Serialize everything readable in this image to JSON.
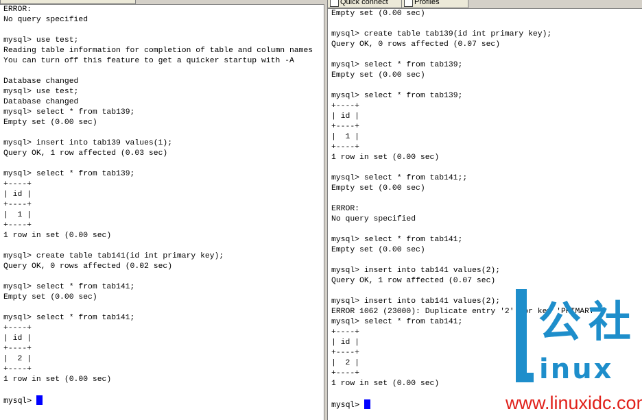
{
  "right_tabs": {
    "tab1": "Quick connect",
    "tab2": "Profiles"
  },
  "left_terminal": {
    "lines": [
      "ERROR:",
      "No query specified",
      "",
      "mysql> use test;",
      "Reading table information for completion of table and column names",
      "You can turn off this feature to get a quicker startup with -A",
      "",
      "Database changed",
      "mysql> use test;",
      "Database changed",
      "mysql> select * from tab139;",
      "Empty set (0.00 sec)",
      "",
      "mysql> insert into tab139 values(1);",
      "Query OK, 1 row affected (0.03 sec)",
      "",
      "mysql> select * from tab139;",
      "+----+",
      "| id |",
      "+----+",
      "|  1 |",
      "+----+",
      "1 row in set (0.00 sec)",
      "",
      "mysql> create table tab141(id int primary key);",
      "Query OK, 0 rows affected (0.02 sec)",
      "",
      "mysql> select * from tab141;",
      "Empty set (0.00 sec)",
      "",
      "mysql> select * from tab141;",
      "+----+",
      "| id |",
      "+----+",
      "|  2 |",
      "+----+",
      "1 row in set (0.00 sec)",
      ""
    ],
    "prompt": "mysql> "
  },
  "right_terminal": {
    "lines": [
      "Empty set (0.00 sec)",
      "",
      "mysql> create table tab139(id int primary key);",
      "Query OK, 0 rows affected (0.07 sec)",
      "",
      "mysql> select * from tab139;",
      "Empty set (0.00 sec)",
      "",
      "mysql> select * from tab139;",
      "+----+",
      "| id |",
      "+----+",
      "|  1 |",
      "+----+",
      "1 row in set (0.00 sec)",
      "",
      "mysql> select * from tab141;;",
      "Empty set (0.00 sec)",
      "",
      "ERROR:",
      "No query specified",
      "",
      "mysql> select * from tab141;",
      "Empty set (0.00 sec)",
      "",
      "mysql> insert into tab141 values(2);",
      "Query OK, 1 row affected (0.07 sec)",
      "",
      "mysql> insert into tab141 values(2);",
      "ERROR 1062 (23000): Duplicate entry '2' for key 'PRIMARY'",
      "mysql> select * from tab141;",
      "+----+",
      "| id |",
      "+----+",
      "|  2 |",
      "+----+",
      "1 row in set (0.00 sec)",
      ""
    ],
    "prompt": "mysql> "
  },
  "watermark": {
    "cn_1": "公",
    "cn_2": "社",
    "brand": "inux",
    "url": "www.linuxidc.com",
    "colors": {
      "brand_blue": "#1e8ecb",
      "url_red": "#e0201a"
    }
  },
  "colors": {
    "cursor": "#0000ff",
    "terminal_bg": "#ffffff",
    "chrome": "#d4d0c8"
  }
}
